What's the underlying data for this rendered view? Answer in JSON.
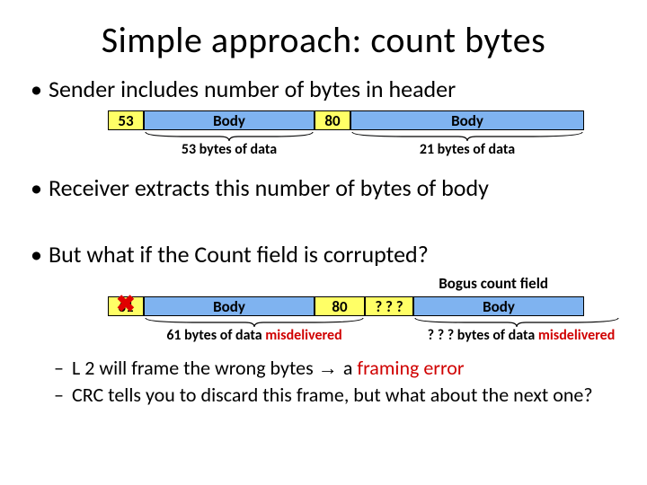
{
  "title": "Simple approach: count bytes",
  "bullet1": "Sender includes number of bytes in header",
  "bullet2": "Receiver extracts this number of bytes of body",
  "bullet3": "But what if the Count field is corrupted?",
  "bogus_label": "Bogus count field",
  "sub1_a": "L 2 will frame the wrong bytes ",
  "sub1_arrow": "→ ",
  "sub1_b": "a ",
  "sub1_c": "framing error",
  "sub2": "CRC tells you to discard this frame, but what about the next one?",
  "d1": {
    "h1": "53",
    "b1": "Body",
    "h2": "80",
    "b2": "Body",
    "l1": "53 bytes of data",
    "l2": "21 bytes of data"
  },
  "d2": {
    "h1": "61",
    "b1": "Body",
    "h2": "80",
    "q": "? ? ?",
    "b2": "Body",
    "l1a": "61 bytes of data ",
    "l1b": "misdelivered",
    "l2a": "? ? ? bytes of data ",
    "l2b": "misdelivered"
  }
}
